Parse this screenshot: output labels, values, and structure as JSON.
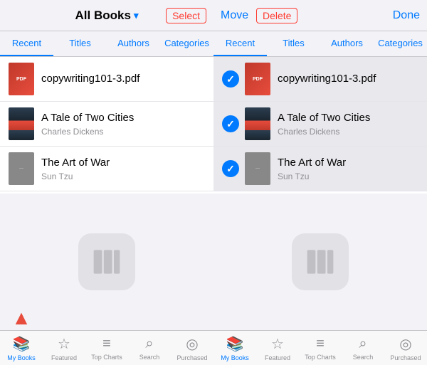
{
  "left_panel": {
    "header": {
      "title": "All Books",
      "title_suffix": "▾",
      "select_btn": "Select"
    },
    "tabs": [
      {
        "label": "Recent",
        "active": true
      },
      {
        "label": "Titles",
        "active": false
      },
      {
        "label": "Authors",
        "active": false
      },
      {
        "label": "Categories",
        "active": false
      }
    ],
    "books": [
      {
        "title": "copywriting101-3.pdf",
        "author": "",
        "type": "pdf"
      },
      {
        "title": "A Tale of Two Cities",
        "author": "Charles Dickens",
        "type": "tale"
      },
      {
        "title": "The Art of War",
        "author": "Sun Tzu",
        "type": "war"
      }
    ],
    "tab_bar": [
      {
        "label": "My Books",
        "active": true,
        "icon": "📚"
      },
      {
        "label": "Featured",
        "active": false,
        "icon": "☆"
      },
      {
        "label": "Top Charts",
        "active": false,
        "icon": "≡"
      },
      {
        "label": "Search",
        "active": false,
        "icon": "⌕"
      },
      {
        "label": "Purchased",
        "active": false,
        "icon": "◎"
      }
    ]
  },
  "right_panel": {
    "header": {
      "move_btn": "Move",
      "delete_btn": "Delete",
      "done_btn": "Done"
    },
    "tabs": [
      {
        "label": "Recent",
        "active": true
      },
      {
        "label": "Titles",
        "active": false
      },
      {
        "label": "Authors",
        "active": false
      },
      {
        "label": "Categories",
        "active": false
      }
    ],
    "books": [
      {
        "title": "copywriting101-3.pdf",
        "author": "",
        "type": "pdf",
        "selected": true
      },
      {
        "title": "A Tale of Two Cities",
        "author": "Charles Dickens",
        "type": "tale",
        "selected": true
      },
      {
        "title": "The Art of War",
        "author": "Sun Tzu",
        "type": "war",
        "selected": true
      }
    ],
    "tab_bar": [
      {
        "label": "My Books",
        "active": true,
        "icon": "📚"
      },
      {
        "label": "Featured",
        "active": false,
        "icon": "☆"
      },
      {
        "label": "Top Charts",
        "active": false,
        "icon": "≡"
      },
      {
        "label": "Search",
        "active": false,
        "icon": "⌕"
      },
      {
        "label": "Purchased",
        "active": false,
        "icon": "◎"
      }
    ]
  }
}
